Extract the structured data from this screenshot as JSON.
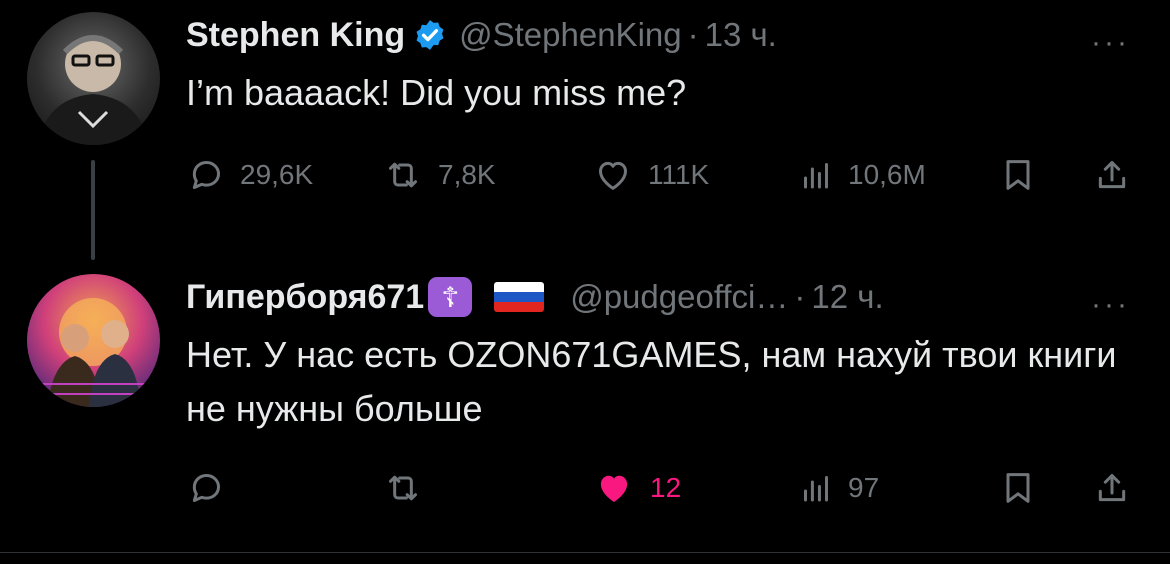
{
  "tweets": [
    {
      "author": {
        "name": "Stephen King",
        "handle": "@StephenKing",
        "verified": true
      },
      "time": "13 ч.",
      "text": "I’m baaaack! Did you miss me?",
      "stats": {
        "replies": "29,6K",
        "reposts": "7,8K",
        "likes": "111K",
        "views": "10,6M"
      },
      "liked": false
    },
    {
      "author": {
        "name": "Гиперборя671",
        "handle": "@pudgeoffci…",
        "badge": "cross-badge",
        "flag": "russia-flag"
      },
      "time": "12 ч.",
      "text": "Нет. У нас есть OZON671GAMES, нам нахуй твои книги не нужны больше",
      "stats": {
        "replies": "",
        "reposts": "",
        "likes": "12",
        "views": "97"
      },
      "liked": true
    }
  ],
  "separator": "·",
  "more": "···",
  "colors": {
    "background": "#000000",
    "text": "#e7e9ea",
    "muted": "#71767b",
    "verified": "#1d9bf0",
    "like": "#f91880"
  },
  "icons": [
    "reply-icon",
    "repost-icon",
    "like-icon",
    "views-icon",
    "bookmark-icon",
    "share-icon"
  ]
}
